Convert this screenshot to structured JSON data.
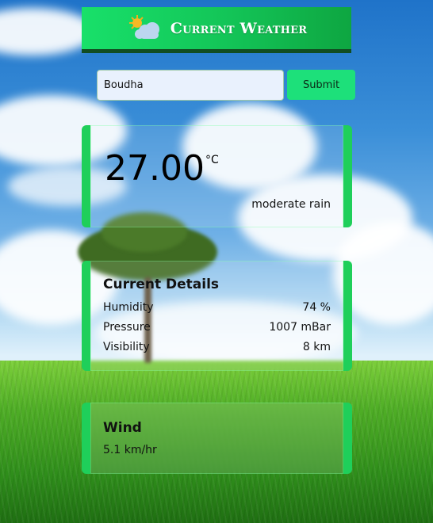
{
  "header": {
    "title": "Current Weather",
    "icon": "sun-cloud-icon"
  },
  "search": {
    "value": "Boudha",
    "submit_label": "Submit"
  },
  "current": {
    "temperature": "27.00",
    "unit": "°C",
    "condition": "moderate rain"
  },
  "details": {
    "title": "Current Details",
    "rows": [
      {
        "label": "Humidity",
        "value": "74 %"
      },
      {
        "label": "Pressure",
        "value": "1007 mBar"
      },
      {
        "label": "Visibility",
        "value": "8 km"
      }
    ]
  },
  "wind": {
    "title": "Wind",
    "speed": "5.1 km/hr"
  },
  "colors": {
    "accent": "#1fcf5a",
    "header": "#13c457",
    "button": "#1de07a"
  }
}
